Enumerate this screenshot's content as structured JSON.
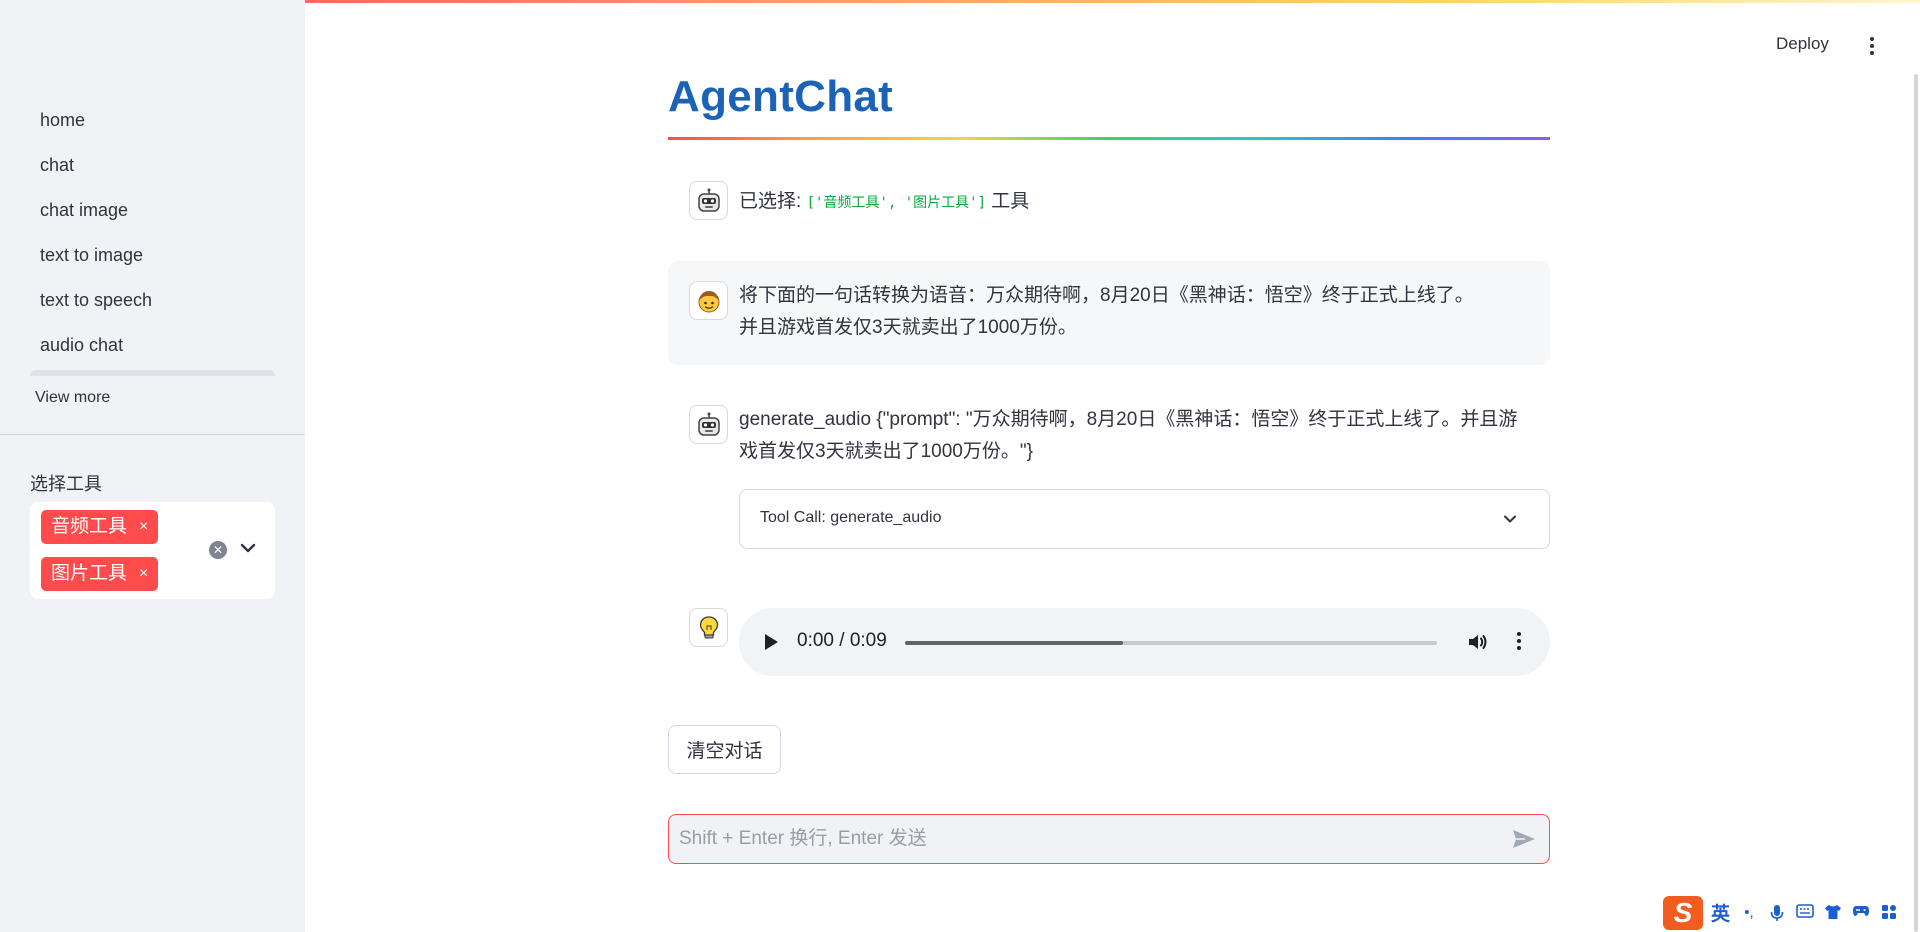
{
  "sidebar": {
    "nav_items": [
      {
        "label": "home"
      },
      {
        "label": "chat"
      },
      {
        "label": "chat image"
      },
      {
        "label": "text to image"
      },
      {
        "label": "text to speech"
      },
      {
        "label": "audio chat"
      }
    ],
    "view_more": "View more",
    "select_label": "选择工具",
    "selected_tools": [
      "音频工具",
      "图片工具"
    ],
    "chip_remove": "×"
  },
  "header": {
    "deploy": "Deploy"
  },
  "main": {
    "title": "AgentChat",
    "messages": [
      {
        "role": "assistant",
        "prefix": "已选择:",
        "code": "['音频工具', '图片工具']",
        "suffix": "工具"
      },
      {
        "role": "user",
        "text_line1": "将下面的一句话转换为语音：万众期待啊，8月20日《黑神话：悟空》终于正式上线了。",
        "text_line2": "并且游戏首发仅3天就卖出了1000万份。"
      },
      {
        "role": "assistant",
        "text_line1": "generate_audio {\"prompt\": \"万众期待啊，8月20日《黑神话：悟空》终于正式上线了。并且游",
        "text_line2": "戏首发仅3天就卖出了1000万份。\"}",
        "expander_label": "Tool Call: generate_audio"
      },
      {
        "role": "tool",
        "audio_time": "0:00 / 0:09",
        "audio_progress": 0.41
      }
    ],
    "clear_button": "清空对话",
    "input_placeholder": "Shift + Enter 换行, Enter 发送"
  },
  "ime": {
    "logo": "S",
    "lang": "英",
    "icons": [
      "punctuation-icon",
      "microphone-icon",
      "keyboard-icon",
      "skin-icon",
      "game-icon",
      "apps-icon"
    ]
  },
  "colors": {
    "accent": "#ff4b4b",
    "title": "#1c63b7",
    "sidebar_bg": "#f0f2f6",
    "code_green": "#09ab3b"
  }
}
